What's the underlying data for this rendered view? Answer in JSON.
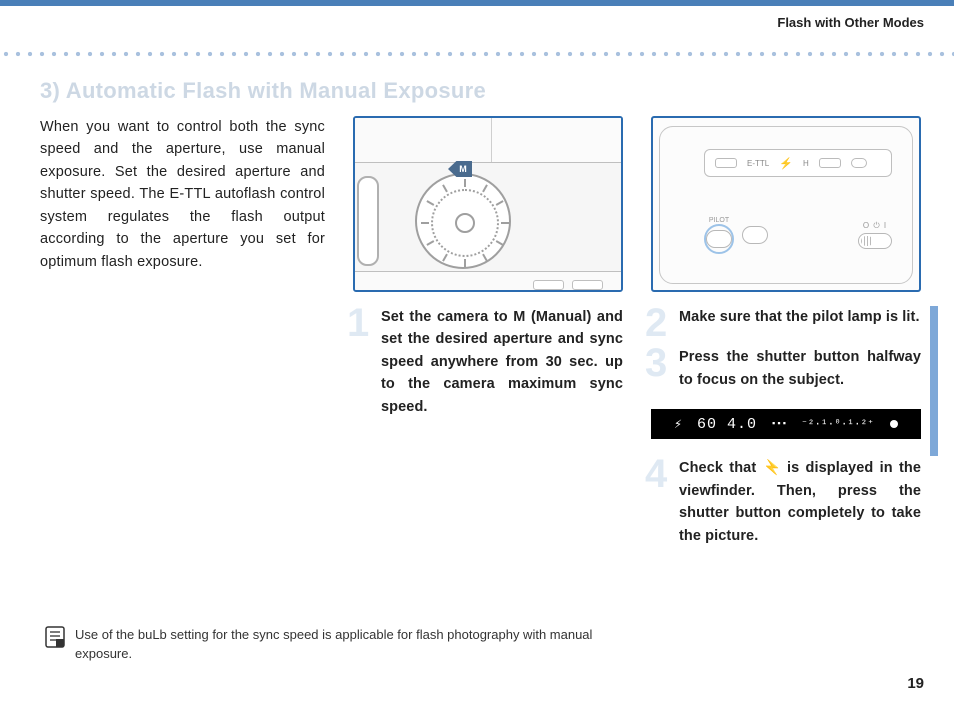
{
  "header": {
    "title": "Flash with Other Modes"
  },
  "section": {
    "title": "3) Automatic Flash with Manual Exposure"
  },
  "intro": "When you want to control both the sync speed and the aperture, use manual exposure. Set the desired aperture and shutter speed. The E-TTL autoflash control system regulates the flash output according to the aperture you set for optimum flash exposure.",
  "steps": {
    "s1": {
      "num": "1",
      "text": "Set the camera to M (Manual) and set the desired aperture and sync speed anywhere from 30 sec. up to the camera maximum sync speed."
    },
    "s2": {
      "num": "2",
      "text": "Make sure that the pilot lamp is lit."
    },
    "s3": {
      "num": "3",
      "text": "Press the shutter button halfway to focus on the subject."
    },
    "s4": {
      "num": "4",
      "text_before": "Check that ",
      "text_after": " is displayed in the viewfinder. Then, press the shutter button completely to take the picture."
    }
  },
  "viewfinder": {
    "readout": "60 4.0",
    "scale": "⁻²·¹·⁰·¹·²⁺"
  },
  "flash_panel": {
    "lcd_labels": [
      "E-TTL",
      "H"
    ],
    "pilot_label": "PILOT",
    "power_label": "O ⏻ I"
  },
  "camera_dial": {
    "pointer_label": "M"
  },
  "footnote": "Use of the buLb setting for the sync speed is applicable for flash photography with manual exposure.",
  "page_number": "19"
}
